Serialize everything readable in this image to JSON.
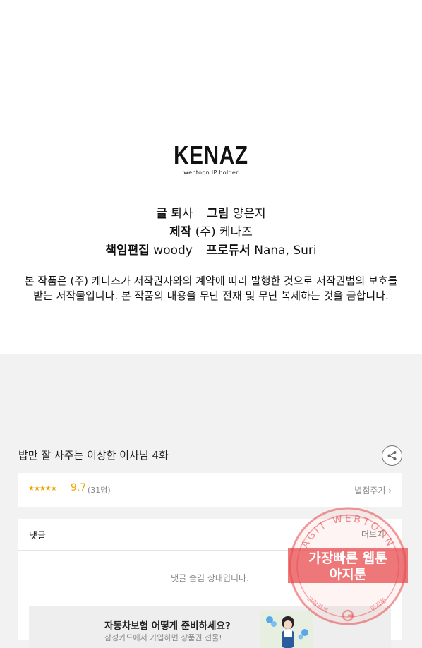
{
  "logo": {
    "name": "KENAZ",
    "tagline": "webtoon IP holder"
  },
  "credits": {
    "story_label": "글",
    "story": "퇴사",
    "art_label": "그림",
    "art": "양은지",
    "production_label": "제작",
    "production": "(주) 케나즈",
    "editor_label": "책임편집",
    "editor": "woody",
    "producer_label": "프로듀서",
    "producer": "Nana, Suri"
  },
  "notice": {
    "line1": "본 작품은 (주) 케나즈가 저작권자와의 계약에 따라 발행한 것으로 저작권법의 보호를",
    "line2": "받는 저작물입니다. 본 작품의 내용을 무단 전재 및 무단 복제하는 것을 금합니다."
  },
  "episode": {
    "title": "밥만 잘 사주는 이상한 이사님 4화",
    "share_icon": "share-icon"
  },
  "rating": {
    "stars": "★★★★★",
    "score": "9.7",
    "count": "(31명)",
    "rate_label": "별점주기 ›"
  },
  "comments": {
    "title": "댓글",
    "more_label": "더보기",
    "hidden_message": "댓글 숨김 상태입니다."
  },
  "ad": {
    "title": "자동차보험 어떻게 준비하세요?",
    "subtitle": "삼성카드에서 가입하면 상품권 선물!"
  },
  "watermark": {
    "arc_text": "AGIT WEBTOON",
    "line1": "가장빠른 웹툰",
    "line2": "아지툰",
    "bottom_left": "그림검색",
    "bottom_right": "아지툰"
  },
  "colors": {
    "accent": "#f0a400",
    "watermark": "#e8474a"
  }
}
